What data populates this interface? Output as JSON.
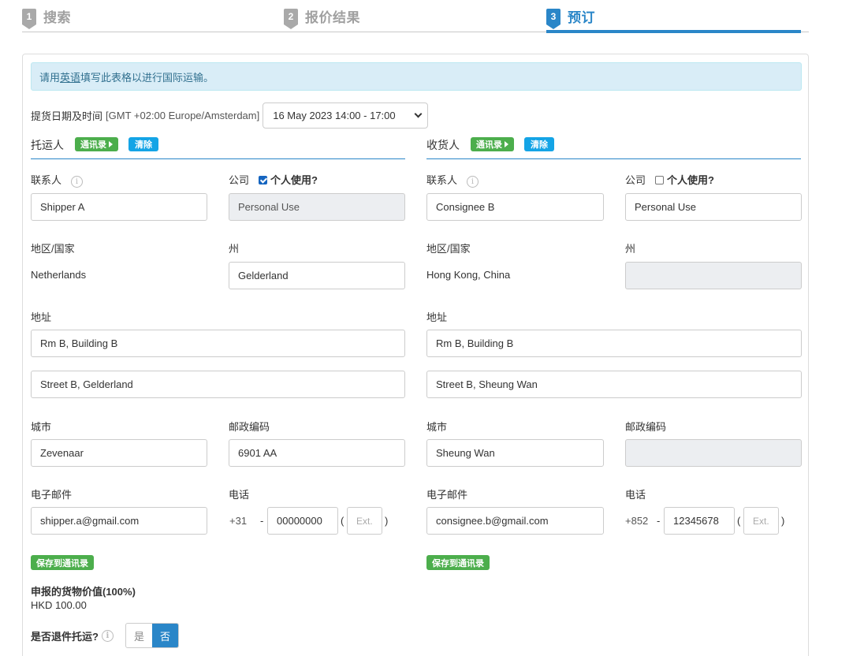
{
  "steps": [
    {
      "num": "1",
      "label": "搜索"
    },
    {
      "num": "2",
      "label": "报价结果"
    },
    {
      "num": "3",
      "label": "预订"
    }
  ],
  "notice": {
    "prefix": "请用",
    "highlight": "英语",
    "suffix": "填写此表格以进行国际运输。"
  },
  "pickup": {
    "label": "提货日期及时间",
    "timezone": "[GMT +02:00 Europe/Amsterdam]",
    "selected": "16 May 2023 14:00 - 17:00"
  },
  "shipper": {
    "title": "托运人",
    "address_book": "通讯录",
    "clear": "清除",
    "contact_label": "联系人",
    "contact": "Shipper A",
    "company_label": "公司",
    "personal_label": "个人使用?",
    "personal_checked": true,
    "company": "Personal Use",
    "country_label": "地区/国家",
    "country": "Netherlands",
    "state_label": "州",
    "state": "Gelderland",
    "address_label": "地址",
    "address1": "Rm B, Building B",
    "address2": "Street B, Gelderland",
    "city_label": "城市",
    "city": "Zevenaar",
    "postal_label": "邮政编码",
    "postal": "6901 AA",
    "email_label": "电子邮件",
    "email": "shipper.a@gmail.com",
    "phone_label": "电话",
    "phone_code": "+31",
    "phone": "00000000",
    "ext_placeholder": "Ext.",
    "save": "保存到通讯录"
  },
  "consignee": {
    "title": "收货人",
    "address_book": "通讯录",
    "clear": "清除",
    "contact_label": "联系人",
    "contact": "Consignee B",
    "company_label": "公司",
    "personal_label": "个人使用?",
    "personal_checked": false,
    "company": "Personal Use",
    "country_label": "地区/国家",
    "country": "Hong Kong, China",
    "state_label": "州",
    "state": "",
    "address_label": "地址",
    "address1": "Rm B, Building B",
    "address2": "Street B, Sheung Wan",
    "city_label": "城市",
    "city": "Sheung Wan",
    "postal_label": "邮政编码",
    "postal": "",
    "email_label": "电子邮件",
    "email": "consignee.b@gmail.com",
    "phone_label": "电话",
    "phone_code": "+852",
    "phone": "12345678",
    "ext_placeholder": "Ext.",
    "save": "保存到通讯录"
  },
  "declared": {
    "label": "申报的货物价值(100%)",
    "value": "HKD 100.00"
  },
  "return": {
    "label": "是否退件托运?",
    "yes": "是",
    "no": "否",
    "selected": "no"
  },
  "colors": {
    "primary": "#2a86c8",
    "green": "#4cae4c",
    "blue_btn": "#14a4e6",
    "info_bg": "#d9edf7"
  }
}
